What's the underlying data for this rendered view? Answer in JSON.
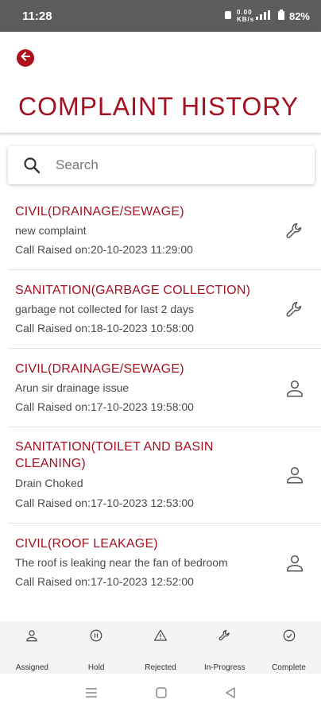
{
  "status_bar": {
    "time": "11:28",
    "network": "0.00 KB/s",
    "battery": "82%"
  },
  "header": {
    "title": "COMPLAINT HISTORY"
  },
  "search": {
    "placeholder": "Search"
  },
  "complaints": [
    {
      "category": "CIVIL(DRAINAGE/SEWAGE)",
      "description": "new complaint",
      "date": "Call Raised on:20-10-2023 11:29:00",
      "status_icon": "wrench-icon"
    },
    {
      "category": "SANITATION(GARBAGE COLLECTION)",
      "description": "garbage not collected for last 2 days",
      "date": "Call Raised on:18-10-2023 10:58:00",
      "status_icon": "wrench-icon"
    },
    {
      "category": "CIVIL(DRAINAGE/SEWAGE)",
      "description": "Arun sir drainage issue",
      "date": "Call Raised on:17-10-2023 19:58:00",
      "status_icon": "person-icon"
    },
    {
      "category": "SANITATION(TOILET AND BASIN CLEANING)",
      "description": "Drain Choked",
      "date": "Call Raised on:17-10-2023 12:53:00",
      "status_icon": "person-icon"
    },
    {
      "category": "CIVIL(ROOF LEAKAGE)",
      "description": "The roof is leaking near the fan of bedroom",
      "date": "Call Raised on:17-10-2023 12:52:00",
      "status_icon": "person-icon"
    }
  ],
  "bottom_nav": [
    {
      "label": "Assigned",
      "icon": "person-icon"
    },
    {
      "label": "Hold",
      "icon": "pause-icon"
    },
    {
      "label": "Rejected",
      "icon": "warning-icon"
    },
    {
      "label": "In-Progress",
      "icon": "wrench-icon"
    },
    {
      "label": "Complete",
      "icon": "check-circle-icon"
    }
  ],
  "colors": {
    "accent": "#a31220",
    "status_bar": "#5c5c5c"
  }
}
